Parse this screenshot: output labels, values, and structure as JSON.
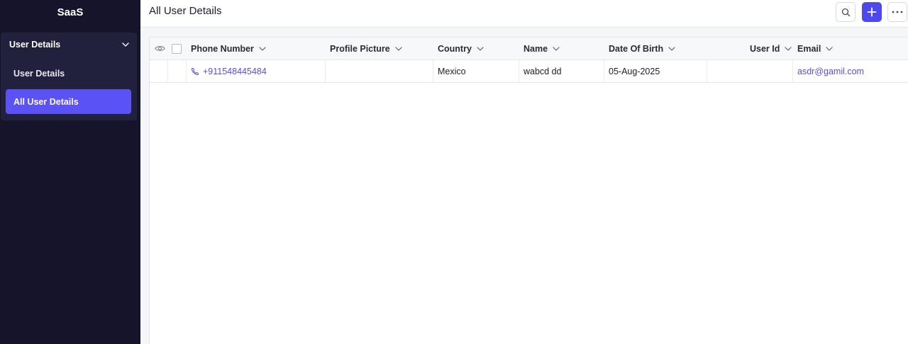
{
  "app": {
    "name": "SaaS"
  },
  "sidebar": {
    "group_label": "User Details",
    "items": [
      {
        "label": "User Details"
      },
      {
        "label": "All User Details",
        "active": true
      }
    ]
  },
  "header": {
    "title": "All User Details"
  },
  "table": {
    "columns": [
      "Phone Number",
      "Profile Picture",
      "Country",
      "Name",
      "Date Of Birth",
      "User Id",
      "Email"
    ],
    "rows": [
      {
        "phone": "+911548445484",
        "profile_picture": "",
        "country": "Mexico",
        "name": "wabcd dd",
        "dob": "05-Aug-2025",
        "user_id": "",
        "email": "asdr@gamil.com"
      }
    ]
  },
  "icons": {
    "search": "search-icon",
    "add": "plus-icon",
    "more": "more-horizontal-icon",
    "view": "eye-icon",
    "phone": "phone-icon",
    "sort": "chevron-down-icon",
    "group_toggle": "chevron-down-icon"
  },
  "colors": {
    "sidebar_bg": "#15142b",
    "sidebar_group_bg": "#22213d",
    "accent": "#5b52f5",
    "link": "#5650d8"
  }
}
